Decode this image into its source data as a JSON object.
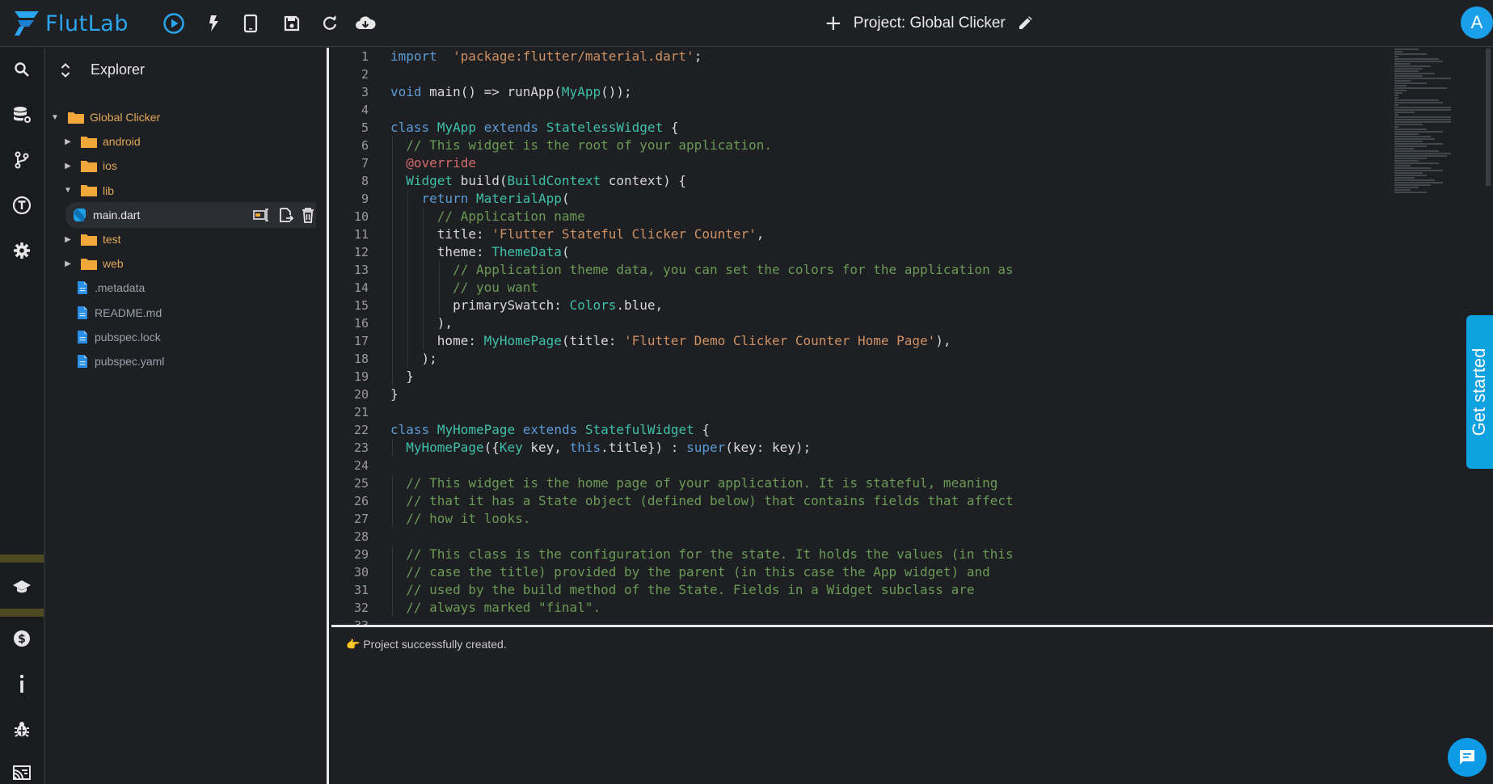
{
  "app": {
    "name": "FlutLab"
  },
  "toolbar": {
    "run_icon": "play-circle-icon",
    "hot_reload_icon": "bolt-icon",
    "device_icon": "phone-icon",
    "save_icon": "save-icon",
    "refresh_icon": "refresh-icon",
    "download_icon": "cloud-download-icon"
  },
  "project": {
    "label": "Project: Global Clicker"
  },
  "user": {
    "initial": "A"
  },
  "explorer": {
    "title": "Explorer",
    "items": [
      {
        "name": "Global Clicker",
        "type": "folder",
        "level": 0,
        "expanded": true
      },
      {
        "name": "android",
        "type": "folder",
        "level": 1,
        "expanded": false
      },
      {
        "name": "ios",
        "type": "folder",
        "level": 1,
        "expanded": false
      },
      {
        "name": "lib",
        "type": "folder",
        "level": 1,
        "expanded": true
      },
      {
        "name": "main.dart",
        "type": "dart",
        "level": 2,
        "selected": true
      },
      {
        "name": "test",
        "type": "folder",
        "level": 1,
        "expanded": false
      },
      {
        "name": "web",
        "type": "folder",
        "level": 1,
        "expanded": false
      },
      {
        "name": ".metadata",
        "type": "file",
        "level": 1
      },
      {
        "name": "README.md",
        "type": "file",
        "level": 1
      },
      {
        "name": "pubspec.lock",
        "type": "file",
        "level": 1
      },
      {
        "name": "pubspec.yaml",
        "type": "file",
        "level": 1
      }
    ]
  },
  "editor": {
    "lines": [
      [
        [
          "kw",
          "import"
        ],
        [
          "",
          "  "
        ],
        [
          "str",
          "'package:flutter/material.dart'"
        ],
        [
          "",
          ";"
        ]
      ],
      [],
      [
        [
          "kw",
          "void"
        ],
        [
          "",
          " main() => runApp("
        ],
        [
          "cls",
          "MyApp"
        ],
        [
          "",
          "());"
        ]
      ],
      [],
      [
        [
          "kw",
          "class"
        ],
        [
          "",
          " "
        ],
        [
          "cls",
          "MyApp"
        ],
        [
          "",
          " "
        ],
        [
          "kw",
          "extends"
        ],
        [
          "",
          " "
        ],
        [
          "cls",
          "StatelessWidget"
        ],
        [
          "",
          " {"
        ]
      ],
      [
        [
          "",
          "  "
        ],
        [
          "cmt",
          "// This widget is the root of your application."
        ]
      ],
      [
        [
          "",
          "  "
        ],
        [
          "ann",
          "@override"
        ]
      ],
      [
        [
          "",
          "  "
        ],
        [
          "cls",
          "Widget"
        ],
        [
          "",
          " build("
        ],
        [
          "cls",
          "BuildContext"
        ],
        [
          "",
          " context) {"
        ]
      ],
      [
        [
          "",
          "    "
        ],
        [
          "kw",
          "return"
        ],
        [
          "",
          " "
        ],
        [
          "cls",
          "MaterialApp"
        ],
        [
          "",
          "("
        ]
      ],
      [
        [
          "",
          "      "
        ],
        [
          "cmt",
          "// Application name"
        ]
      ],
      [
        [
          "",
          "      title: "
        ],
        [
          "str",
          "'Flutter Stateful Clicker Counter'"
        ],
        [
          "",
          ","
        ]
      ],
      [
        [
          "",
          "      theme: "
        ],
        [
          "cls",
          "ThemeData"
        ],
        [
          "",
          "("
        ]
      ],
      [
        [
          "",
          "        "
        ],
        [
          "cmt",
          "// Application theme data, you can set the colors for the application as"
        ]
      ],
      [
        [
          "",
          "        "
        ],
        [
          "cmt",
          "// you want"
        ]
      ],
      [
        [
          "",
          "        primarySwatch: "
        ],
        [
          "cls",
          "Colors"
        ],
        [
          "",
          ".blue,"
        ]
      ],
      [
        [
          "",
          "      ),"
        ]
      ],
      [
        [
          "",
          "      home: "
        ],
        [
          "cls",
          "MyHomePage"
        ],
        [
          "",
          "(title: "
        ],
        [
          "str",
          "'Flutter Demo Clicker Counter Home Page'"
        ],
        [
          "",
          "),"
        ]
      ],
      [
        [
          "",
          "    );"
        ]
      ],
      [
        [
          "",
          "  }"
        ]
      ],
      [
        [
          "",
          "}"
        ]
      ],
      [],
      [
        [
          "kw",
          "class"
        ],
        [
          "",
          " "
        ],
        [
          "cls",
          "MyHomePage"
        ],
        [
          "",
          " "
        ],
        [
          "kw",
          "extends"
        ],
        [
          "",
          " "
        ],
        [
          "cls",
          "StatefulWidget"
        ],
        [
          "",
          " {"
        ]
      ],
      [
        [
          "",
          "  "
        ],
        [
          "cls",
          "MyHomePage"
        ],
        [
          "",
          "({"
        ],
        [
          "cls",
          "Key"
        ],
        [
          "",
          " key, "
        ],
        [
          "kw",
          "this"
        ],
        [
          "",
          ".title}) : "
        ],
        [
          "kw",
          "super"
        ],
        [
          "",
          "(key: key);"
        ]
      ],
      [],
      [
        [
          "",
          "  "
        ],
        [
          "cmt",
          "// This widget is the home page of your application. It is stateful, meaning"
        ]
      ],
      [
        [
          "",
          "  "
        ],
        [
          "cmt",
          "// that it has a State object (defined below) that contains fields that affect"
        ]
      ],
      [
        [
          "",
          "  "
        ],
        [
          "cmt",
          "// how it looks."
        ]
      ],
      [],
      [
        [
          "",
          "  "
        ],
        [
          "cmt",
          "// This class is the configuration for the state. It holds the values (in this"
        ]
      ],
      [
        [
          "",
          "  "
        ],
        [
          "cmt",
          "// case the title) provided by the parent (in this case the App widget) and"
        ]
      ],
      [
        [
          "",
          "  "
        ],
        [
          "cmt",
          "// used by the build method of the State. Fields in a Widget subclass are"
        ]
      ],
      [
        [
          "",
          "  "
        ],
        [
          "cmt",
          "// always marked \"final\"."
        ]
      ],
      []
    ]
  },
  "console": {
    "icon": "👉",
    "message": "Project successfully created."
  },
  "get_started": {
    "label": "Get started"
  },
  "colors": {
    "accent": "#1aa0ea",
    "folder": "#f0a83a",
    "background": "#1e1f23"
  }
}
